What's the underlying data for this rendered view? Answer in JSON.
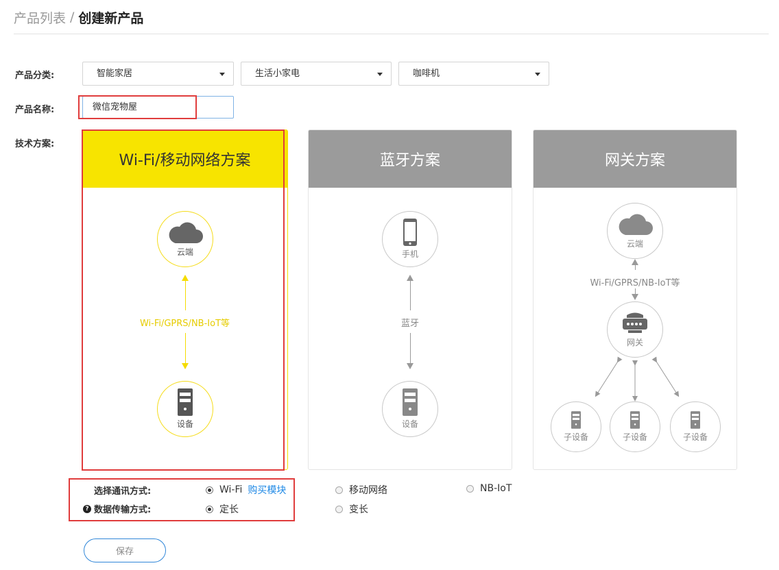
{
  "breadcrumb": {
    "parent": "产品列表",
    "separator": "/",
    "current": "创建新产品"
  },
  "form": {
    "category_label": "产品分类:",
    "category_selects": [
      "智能家居",
      "生活小家电",
      "咖啡机"
    ],
    "name_label": "产品名称:",
    "name_value": "微信宠物屋",
    "tech_label": "技术方案:"
  },
  "cards": {
    "wifi": {
      "title": "Wi-Fi/移动网络方案",
      "top_node": "云端",
      "bottom_node": "设备",
      "link_text": "Wi-Fi/GPRS/NB-IoT等",
      "active": true
    },
    "bluetooth": {
      "title": "蓝牙方案",
      "top_node": "手机",
      "bottom_node": "设备",
      "link_text": "蓝牙"
    },
    "gateway": {
      "title": "网关方案",
      "cloud_node": "云端",
      "link_text": "Wi-Fi/GPRS/NB-IoT等",
      "gateway_node": "网关",
      "sub_nodes": [
        "子设备",
        "子设备",
        "子设备"
      ]
    }
  },
  "comm": {
    "label": "选择通讯方式:",
    "options": [
      "Wi-Fi",
      "移动网络",
      "NB-IoT"
    ],
    "selected": "Wi-Fi",
    "buy_link": "购买模块"
  },
  "transfer": {
    "help_icon": "?",
    "label": "数据传输方式:",
    "options": [
      "定长",
      "变长"
    ],
    "selected": "定长"
  },
  "save_label": "保存",
  "colors": {
    "active_yellow": "#f7e400",
    "inactive_gray": "#9b9b9b",
    "highlight_red": "#e03c3c",
    "link_blue": "#1e88e5"
  }
}
